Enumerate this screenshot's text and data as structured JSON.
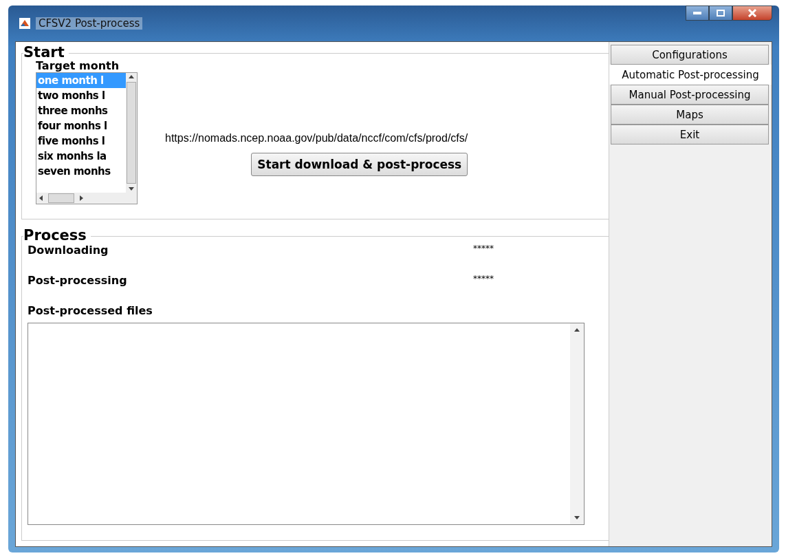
{
  "window": {
    "title": "CFSV2 Post-process"
  },
  "start": {
    "title": "Start",
    "list_label": "Target month",
    "months": [
      {
        "label": "one month l",
        "selected": true
      },
      {
        "label": "two monhs l",
        "selected": false
      },
      {
        "label": "three monhs",
        "selected": false
      },
      {
        "label": "four monhs l",
        "selected": false
      },
      {
        "label": "five monhs l",
        "selected": false
      },
      {
        "label": "six monhs la",
        "selected": false
      },
      {
        "label": "seven monhs",
        "selected": false
      }
    ],
    "url": "https://nomads.ncep.noaa.gov/pub/data/nccf/com/cfs/prod/cfs/",
    "button": "Start download & post-process"
  },
  "process": {
    "title": "Process",
    "rows": [
      {
        "label": "Downloading",
        "status": "*****"
      },
      {
        "label": "Post-processing",
        "status": "*****"
      }
    ],
    "files_label": "Post-processed files"
  },
  "tabs": [
    {
      "label": "Configurations",
      "selected": false
    },
    {
      "label": "Automatic Post-processing",
      "selected": true
    },
    {
      "label": "Manual Post-processing",
      "selected": false
    },
    {
      "label": "Maps",
      "selected": false
    },
    {
      "label": "Exit",
      "selected": false
    }
  ]
}
